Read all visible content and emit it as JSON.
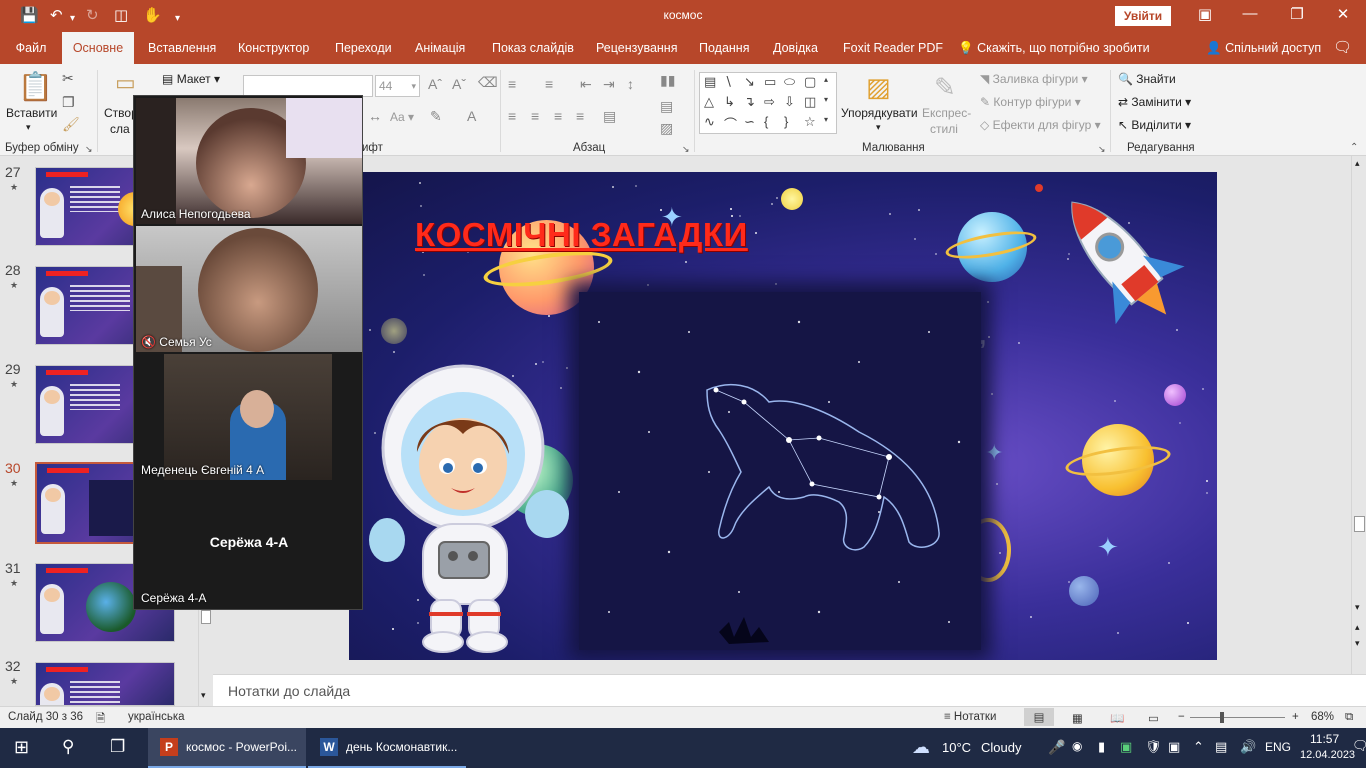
{
  "titlebar": {
    "title": "космос",
    "signin": "Увійти",
    "colors": {
      "accent": "#b7472a"
    }
  },
  "tabs": [
    {
      "label": "Файл"
    },
    {
      "label": "Основне"
    },
    {
      "label": "Вставлення"
    },
    {
      "label": "Конструктор"
    },
    {
      "label": "Переходи"
    },
    {
      "label": "Анімація"
    },
    {
      "label": "Показ слайдів"
    },
    {
      "label": "Рецензування"
    },
    {
      "label": "Подання"
    },
    {
      "label": "Довідка"
    },
    {
      "label": "Foxit Reader PDF"
    }
  ],
  "tell_me": "Скажіть, що потрібно зробити",
  "share": "Спільний доступ",
  "ribbon": {
    "paste": "Вставити",
    "create_slide": "Створ",
    "create_slide_2": "сла",
    "layout": "Макет",
    "font_size": "44",
    "clipboard_group": "Буфер обміну",
    "font_group_tail": "ифт",
    "paragraph_group": "Абзац",
    "drawing_group": "Малювання",
    "editing_group": "Редагування",
    "arrange": "Упорядкувати",
    "express_1": "Експрес-",
    "express_2": "стилі",
    "shape_fill": "Заливка фігури",
    "shape_outline": "Контур фігури",
    "shape_effects": "Ефекти для фігур",
    "find": "Знайти",
    "replace": "Замінити",
    "select": "Виділити"
  },
  "slides": [
    {
      "num": "27",
      "active": false
    },
    {
      "num": "28",
      "active": false
    },
    {
      "num": "29",
      "active": false
    },
    {
      "num": "30",
      "active": true
    },
    {
      "num": "31",
      "active": false
    },
    {
      "num": "32",
      "active": false
    }
  ],
  "slide": {
    "title": "КОСМІЧНІ ЗАГАДКИ",
    "comma": ","
  },
  "notes_placeholder": "Нотатки до слайда",
  "video": {
    "participants": [
      {
        "name": "Алиса Непогодьева"
      },
      {
        "name": "Семья Ус",
        "muted": true
      },
      {
        "name": "Меденець Євгеній 4 А"
      },
      {
        "name": "Серёжа 4-А",
        "big_label": "Серёжа 4-А"
      }
    ]
  },
  "statusbar": {
    "slide_counter": "Слайд 30 з 36",
    "language": "українська",
    "notes": "Нотатки",
    "zoom": "68%"
  },
  "taskbar": {
    "app1": "космос - PowerPoi...",
    "app2": "день Космонавтик...",
    "temperature": "10°C",
    "weather": "Cloudy",
    "lang": "ENG",
    "time": "11:57",
    "date": "12.04.2023"
  }
}
